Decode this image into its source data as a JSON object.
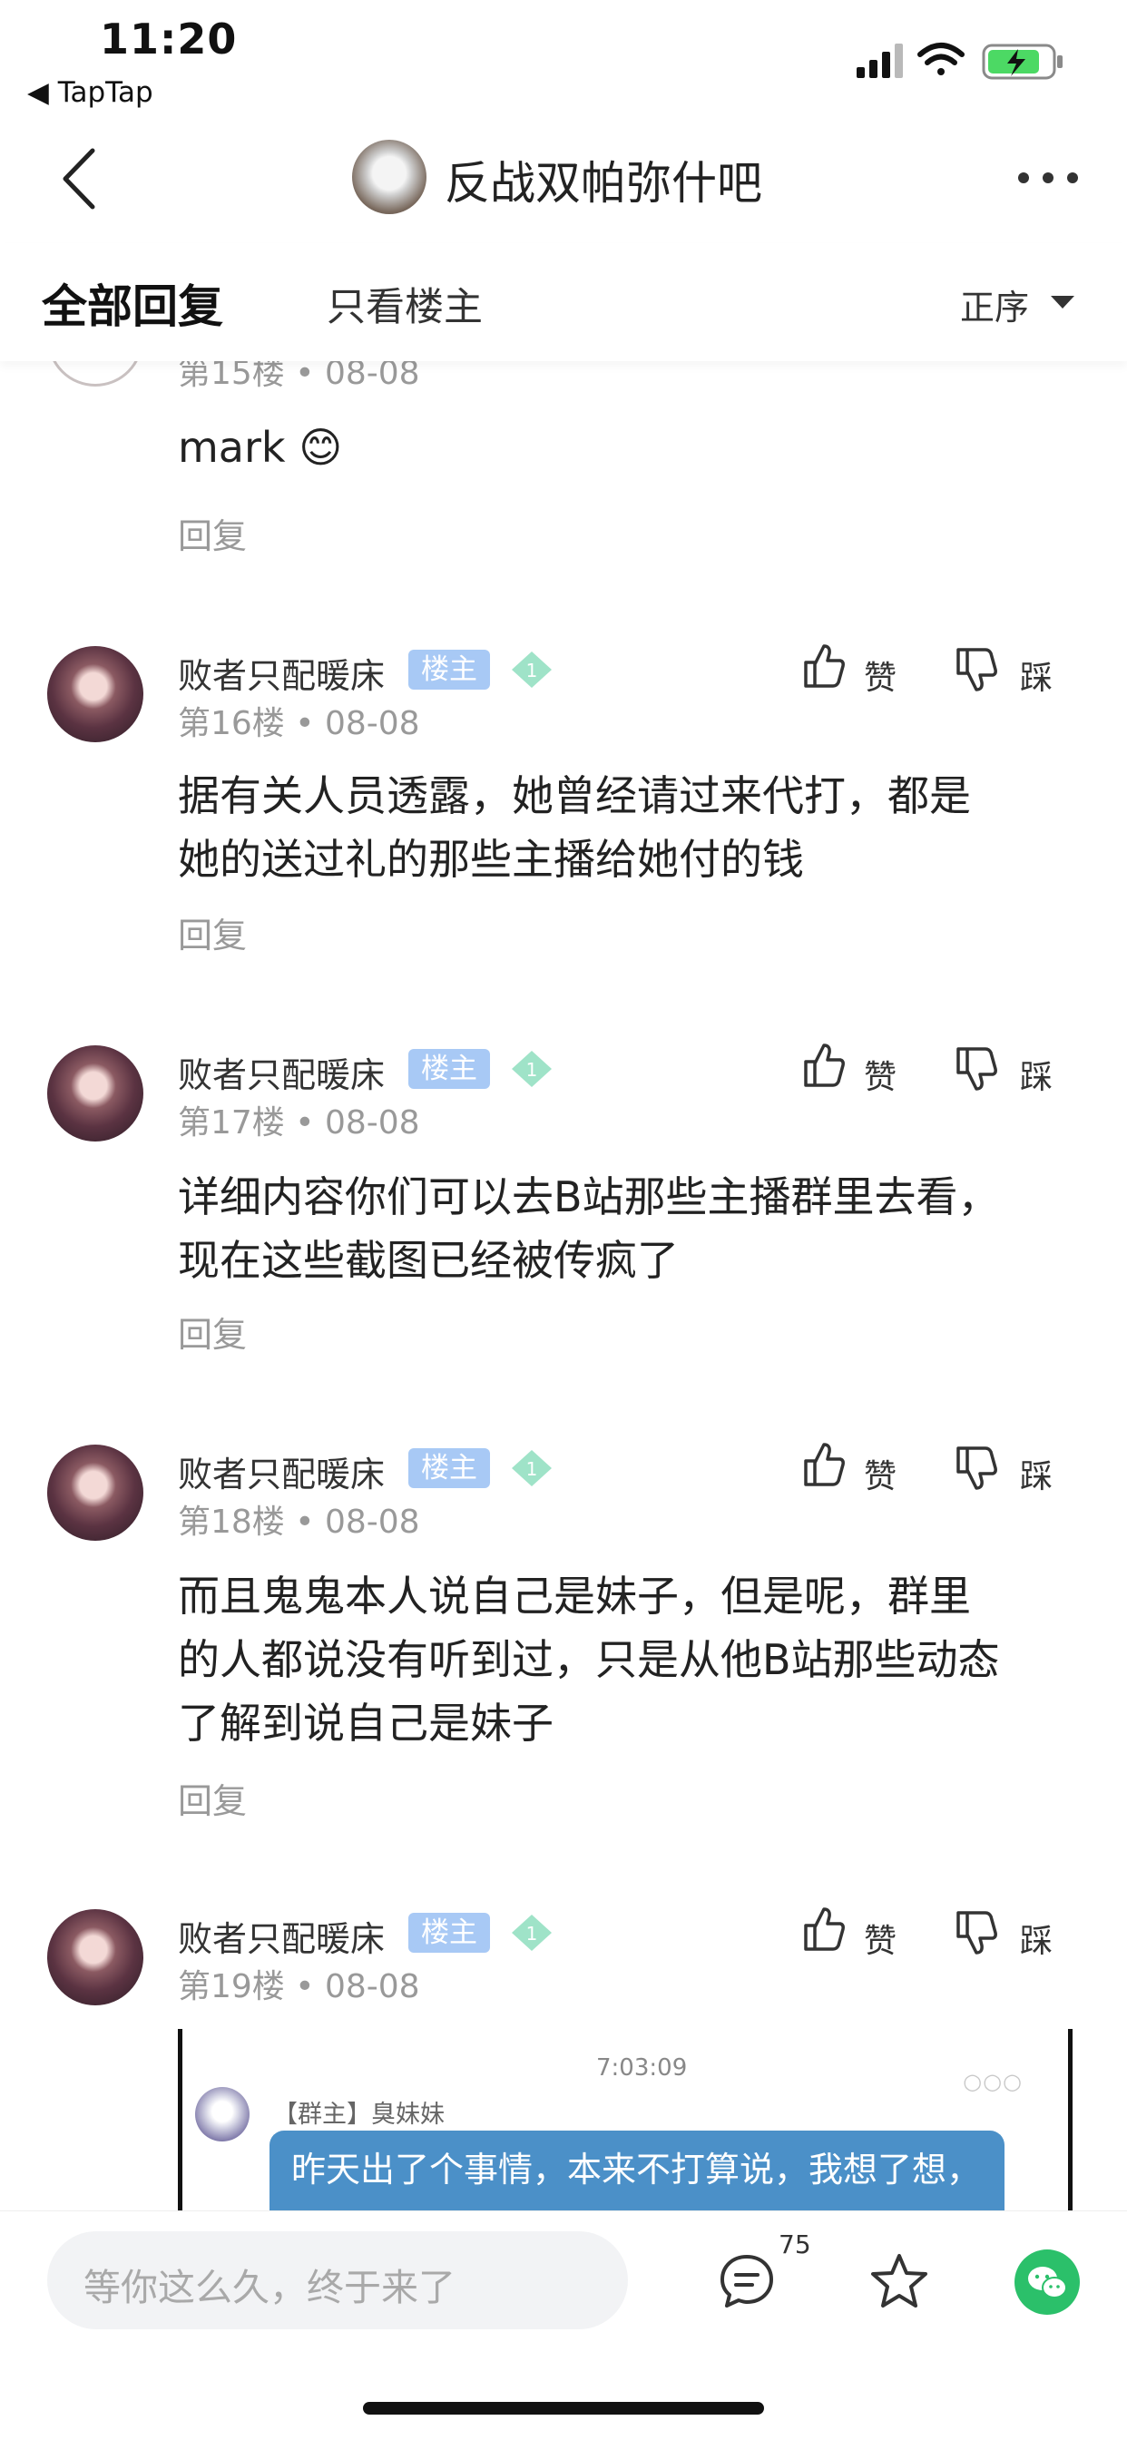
{
  "status_bar": {
    "time": "11:20",
    "back_app": "◀ TapTap"
  },
  "nav": {
    "title": "反战双帕弥什吧"
  },
  "tabs": {
    "all": "全部回复",
    "op_only": "只看楼主",
    "sort": "正序"
  },
  "partial_comment": {
    "floor": "第15楼",
    "date": "• 08-08",
    "text": "mark",
    "emoji": "😊",
    "reply": "回复"
  },
  "comments": [
    {
      "user": "败者只配暖床",
      "badge": "楼主",
      "level": "1",
      "floor": "第16楼",
      "date": "• 08-08",
      "like": "赞",
      "dislike": "踩",
      "lines": [
        "据有关人员透露，她曾经请过来代打，都是",
        "她的送过礼的那些主播给她付的钱"
      ],
      "reply": "回复"
    },
    {
      "user": "败者只配暖床",
      "badge": "楼主",
      "level": "1",
      "floor": "第17楼",
      "date": "• 08-08",
      "like": "赞",
      "dislike": "踩",
      "lines": [
        "详细内容你们可以去B站那些主播群里去看，",
        "现在这些截图已经被传疯了"
      ],
      "reply": "回复"
    },
    {
      "user": "败者只配暖床",
      "badge": "楼主",
      "level": "1",
      "floor": "第18楼",
      "date": "• 08-08",
      "like": "赞",
      "dislike": "踩",
      "lines": [
        "而且鬼鬼本人说自己是妹子，但是呢，群里",
        "的人都说没有听到过，只是从他B站那些动态",
        "了解到说自己是妹子"
      ],
      "reply": "回复"
    },
    {
      "user": "败者只配暖床",
      "badge": "楼主",
      "level": "1",
      "floor": "第19楼",
      "date": "• 08-08",
      "like": "赞",
      "dislike": "踩"
    }
  ],
  "embedded_image": {
    "time": "7:03:09",
    "sender": "【群主】臭妹妹",
    "dots": "○○○",
    "message": "昨天出了个事情，本来不打算说，我想了想，"
  },
  "bottom_bar": {
    "placeholder": "等你这么久，终于来了",
    "comment_count": "75"
  },
  "colors": {
    "op_badge": "#a8c9f5",
    "level_gem": "#9fe3c8",
    "wechat": "#2bc06a",
    "chat_bubble": "#4b90c8"
  }
}
